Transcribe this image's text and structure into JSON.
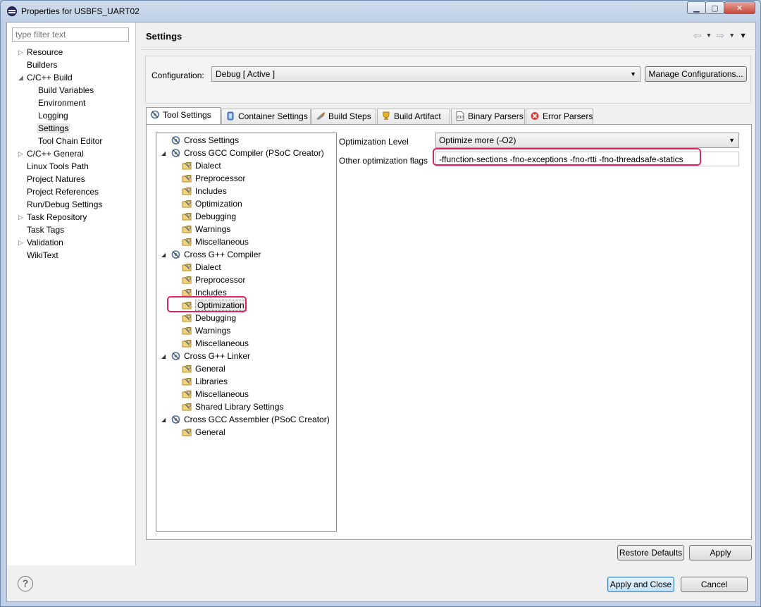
{
  "window": {
    "title": "Properties for USBFS_UART02"
  },
  "filter": {
    "placeholder": "type filter text"
  },
  "nav": [
    {
      "label": "Resource",
      "arrow": "▷"
    },
    {
      "label": "Builders",
      "arrow": ""
    },
    {
      "label": "C/C++ Build",
      "arrow": "◢"
    },
    {
      "label": "Build Variables",
      "arrow": ""
    },
    {
      "label": "Environment",
      "arrow": ""
    },
    {
      "label": "Logging",
      "arrow": ""
    },
    {
      "label": "Settings",
      "arrow": ""
    },
    {
      "label": "Tool Chain Editor",
      "arrow": ""
    },
    {
      "label": "C/C++ General",
      "arrow": "▷"
    },
    {
      "label": "Linux Tools Path",
      "arrow": ""
    },
    {
      "label": "Project Natures",
      "arrow": ""
    },
    {
      "label": "Project References",
      "arrow": ""
    },
    {
      "label": "Run/Debug Settings",
      "arrow": ""
    },
    {
      "label": "Task Repository",
      "arrow": "▷"
    },
    {
      "label": "Task Tags",
      "arrow": ""
    },
    {
      "label": "Validation",
      "arrow": "▷"
    },
    {
      "label": "WikiText",
      "arrow": ""
    }
  ],
  "header": {
    "title": "Settings"
  },
  "config": {
    "label": "Configuration:",
    "value": "Debug  [ Active ]",
    "manage_label": "Manage Configurations..."
  },
  "tabs": [
    {
      "label": "Tool Settings"
    },
    {
      "label": "Container Settings"
    },
    {
      "label": "Build Steps"
    },
    {
      "label": "Build Artifact"
    },
    {
      "label": "Binary Parsers"
    },
    {
      "label": "Error Parsers"
    }
  ],
  "tree": [
    {
      "label": "Cross Settings",
      "exp": ""
    },
    {
      "label": "Cross GCC Compiler (PSoC Creator)",
      "exp": "◢"
    },
    {
      "label": "Dialect",
      "exp": ""
    },
    {
      "label": "Preprocessor",
      "exp": ""
    },
    {
      "label": "Includes",
      "exp": ""
    },
    {
      "label": "Optimization",
      "exp": ""
    },
    {
      "label": "Debugging",
      "exp": ""
    },
    {
      "label": "Warnings",
      "exp": ""
    },
    {
      "label": "Miscellaneous",
      "exp": ""
    },
    {
      "label": "Cross G++ Compiler",
      "exp": "◢"
    },
    {
      "label": "Dialect",
      "exp": ""
    },
    {
      "label": "Preprocessor",
      "exp": ""
    },
    {
      "label": "Includes",
      "exp": ""
    },
    {
      "label": "Optimization",
      "exp": ""
    },
    {
      "label": "Debugging",
      "exp": ""
    },
    {
      "label": "Warnings",
      "exp": ""
    },
    {
      "label": "Miscellaneous",
      "exp": ""
    },
    {
      "label": "Cross G++ Linker",
      "exp": "◢"
    },
    {
      "label": "General",
      "exp": ""
    },
    {
      "label": "Libraries",
      "exp": ""
    },
    {
      "label": "Miscellaneous",
      "exp": ""
    },
    {
      "label": "Shared Library Settings",
      "exp": ""
    },
    {
      "label": "Cross GCC Assembler (PSoC Creator)",
      "exp": "◢"
    },
    {
      "label": "General",
      "exp": ""
    }
  ],
  "optimization": {
    "level_label": "Optimization Level",
    "level_value": "Optimize more (-O2)",
    "flags_label": "Other optimization flags",
    "flags_value": "-ffunction-sections -fno-exceptions -fno-rtti -fno-threadsafe-statics"
  },
  "buttons": {
    "restore": "Restore Defaults",
    "apply": "Apply",
    "apply_close": "Apply and Close",
    "cancel": "Cancel",
    "help": "?"
  },
  "colors": {
    "highlight": "#e0245e",
    "selection": "#e5e5e5"
  }
}
